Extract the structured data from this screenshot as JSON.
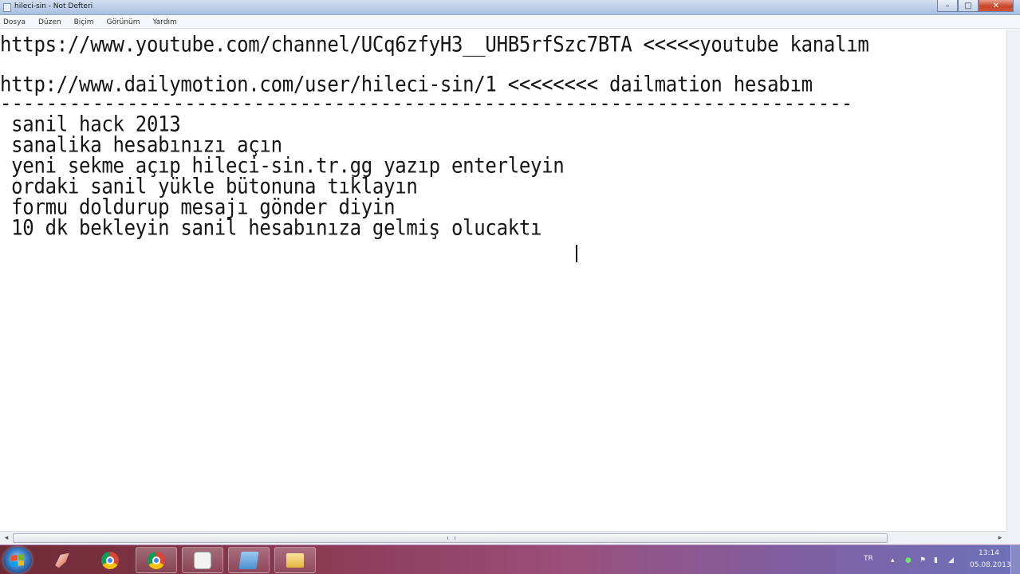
{
  "window": {
    "title": "hileci-sin - Not Defteri",
    "controls": {
      "minimize": "–",
      "maximize": "□",
      "close": "✕"
    }
  },
  "menu": [
    "Dosya",
    "Düzen",
    "Biçim",
    "Görünüm",
    "Yardım"
  ],
  "document": {
    "lines": [
      "https://www.youtube.com/channel/UCq6zfyH3__UHB5rfSzc7BTA <<<<<youtube kanalım",
      "",
      "http://www.dailymotion.com/user/hileci-sin/1 <<<<<<<< dailmation hesabım",
      "--------------------------------------------------------------------------",
      " sanil hack 2013",
      " sanalika hesabınızı açın",
      " yeni sekme açıp hileci-sin.tr.gg yazıp enterleyin",
      " ordaki sanil yükle bütonuna tıklayın",
      " formu doldurup mesajı gönder diyin",
      " 10 dk bekleyin sanil hesabınıza gelmiş olucaktı"
    ]
  },
  "scrollbars": {
    "left_arrow": "◂",
    "right_arrow": "▸"
  },
  "taskbar": {
    "apps": [
      {
        "icon": "paint-icon",
        "name": "paint"
      },
      {
        "icon": "chrome-icon",
        "name": "chrome"
      },
      {
        "icon": "chrome-icon",
        "name": "chrome-2"
      },
      {
        "icon": "chat-icon",
        "name": "messenger"
      },
      {
        "icon": "notepad-icon",
        "name": "notepad"
      },
      {
        "icon": "folder-icon",
        "name": "explorer"
      }
    ],
    "tray": {
      "language": "TR",
      "time": "13:14",
      "date": "05.08.2013"
    }
  }
}
